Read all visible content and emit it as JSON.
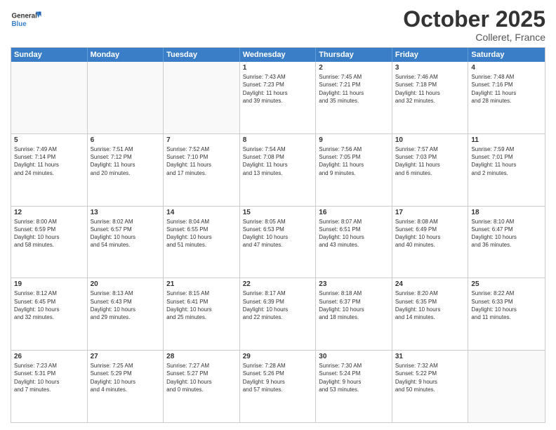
{
  "header": {
    "logo_general": "General",
    "logo_blue": "Blue",
    "month": "October 2025",
    "location": "Colleret, France"
  },
  "weekdays": [
    "Sunday",
    "Monday",
    "Tuesday",
    "Wednesday",
    "Thursday",
    "Friday",
    "Saturday"
  ],
  "rows": [
    [
      {
        "day": "",
        "info": ""
      },
      {
        "day": "",
        "info": ""
      },
      {
        "day": "",
        "info": ""
      },
      {
        "day": "1",
        "info": "Sunrise: 7:43 AM\nSunset: 7:23 PM\nDaylight: 11 hours\nand 39 minutes."
      },
      {
        "day": "2",
        "info": "Sunrise: 7:45 AM\nSunset: 7:21 PM\nDaylight: 11 hours\nand 35 minutes."
      },
      {
        "day": "3",
        "info": "Sunrise: 7:46 AM\nSunset: 7:18 PM\nDaylight: 11 hours\nand 32 minutes."
      },
      {
        "day": "4",
        "info": "Sunrise: 7:48 AM\nSunset: 7:16 PM\nDaylight: 11 hours\nand 28 minutes."
      }
    ],
    [
      {
        "day": "5",
        "info": "Sunrise: 7:49 AM\nSunset: 7:14 PM\nDaylight: 11 hours\nand 24 minutes."
      },
      {
        "day": "6",
        "info": "Sunrise: 7:51 AM\nSunset: 7:12 PM\nDaylight: 11 hours\nand 20 minutes."
      },
      {
        "day": "7",
        "info": "Sunrise: 7:52 AM\nSunset: 7:10 PM\nDaylight: 11 hours\nand 17 minutes."
      },
      {
        "day": "8",
        "info": "Sunrise: 7:54 AM\nSunset: 7:08 PM\nDaylight: 11 hours\nand 13 minutes."
      },
      {
        "day": "9",
        "info": "Sunrise: 7:56 AM\nSunset: 7:05 PM\nDaylight: 11 hours\nand 9 minutes."
      },
      {
        "day": "10",
        "info": "Sunrise: 7:57 AM\nSunset: 7:03 PM\nDaylight: 11 hours\nand 6 minutes."
      },
      {
        "day": "11",
        "info": "Sunrise: 7:59 AM\nSunset: 7:01 PM\nDaylight: 11 hours\nand 2 minutes."
      }
    ],
    [
      {
        "day": "12",
        "info": "Sunrise: 8:00 AM\nSunset: 6:59 PM\nDaylight: 10 hours\nand 58 minutes."
      },
      {
        "day": "13",
        "info": "Sunrise: 8:02 AM\nSunset: 6:57 PM\nDaylight: 10 hours\nand 54 minutes."
      },
      {
        "day": "14",
        "info": "Sunrise: 8:04 AM\nSunset: 6:55 PM\nDaylight: 10 hours\nand 51 minutes."
      },
      {
        "day": "15",
        "info": "Sunrise: 8:05 AM\nSunset: 6:53 PM\nDaylight: 10 hours\nand 47 minutes."
      },
      {
        "day": "16",
        "info": "Sunrise: 8:07 AM\nSunset: 6:51 PM\nDaylight: 10 hours\nand 43 minutes."
      },
      {
        "day": "17",
        "info": "Sunrise: 8:08 AM\nSunset: 6:49 PM\nDaylight: 10 hours\nand 40 minutes."
      },
      {
        "day": "18",
        "info": "Sunrise: 8:10 AM\nSunset: 6:47 PM\nDaylight: 10 hours\nand 36 minutes."
      }
    ],
    [
      {
        "day": "19",
        "info": "Sunrise: 8:12 AM\nSunset: 6:45 PM\nDaylight: 10 hours\nand 32 minutes."
      },
      {
        "day": "20",
        "info": "Sunrise: 8:13 AM\nSunset: 6:43 PM\nDaylight: 10 hours\nand 29 minutes."
      },
      {
        "day": "21",
        "info": "Sunrise: 8:15 AM\nSunset: 6:41 PM\nDaylight: 10 hours\nand 25 minutes."
      },
      {
        "day": "22",
        "info": "Sunrise: 8:17 AM\nSunset: 6:39 PM\nDaylight: 10 hours\nand 22 minutes."
      },
      {
        "day": "23",
        "info": "Sunrise: 8:18 AM\nSunset: 6:37 PM\nDaylight: 10 hours\nand 18 minutes."
      },
      {
        "day": "24",
        "info": "Sunrise: 8:20 AM\nSunset: 6:35 PM\nDaylight: 10 hours\nand 14 minutes."
      },
      {
        "day": "25",
        "info": "Sunrise: 8:22 AM\nSunset: 6:33 PM\nDaylight: 10 hours\nand 11 minutes."
      }
    ],
    [
      {
        "day": "26",
        "info": "Sunrise: 7:23 AM\nSunset: 5:31 PM\nDaylight: 10 hours\nand 7 minutes."
      },
      {
        "day": "27",
        "info": "Sunrise: 7:25 AM\nSunset: 5:29 PM\nDaylight: 10 hours\nand 4 minutes."
      },
      {
        "day": "28",
        "info": "Sunrise: 7:27 AM\nSunset: 5:27 PM\nDaylight: 10 hours\nand 0 minutes."
      },
      {
        "day": "29",
        "info": "Sunrise: 7:28 AM\nSunset: 5:26 PM\nDaylight: 9 hours\nand 57 minutes."
      },
      {
        "day": "30",
        "info": "Sunrise: 7:30 AM\nSunset: 5:24 PM\nDaylight: 9 hours\nand 53 minutes."
      },
      {
        "day": "31",
        "info": "Sunrise: 7:32 AM\nSunset: 5:22 PM\nDaylight: 9 hours\nand 50 minutes."
      },
      {
        "day": "",
        "info": ""
      }
    ]
  ]
}
